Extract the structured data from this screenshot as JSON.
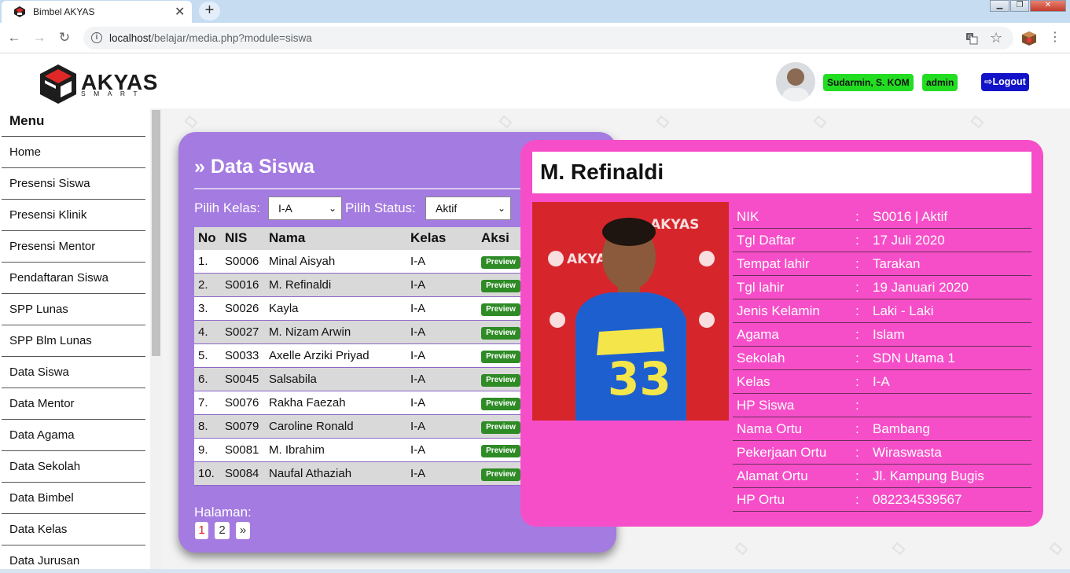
{
  "browser": {
    "tab_title": "Bimbel AKYAS",
    "new_tab": "+",
    "close_tab": "✕",
    "url_host": "localhost",
    "url_path": "/belajar/media.php?module=siswa"
  },
  "header": {
    "logo_text": "AKYAS",
    "logo_sub": "SMART",
    "user_name": "Sudarmin, S. KOM",
    "user_role": "admin",
    "logout_label": "Logout"
  },
  "sidebar": {
    "title": "Menu",
    "items": [
      {
        "label": "Home"
      },
      {
        "label": "Presensi Siswa"
      },
      {
        "label": "Presensi Klinik"
      },
      {
        "label": "Presensi Mentor"
      },
      {
        "label": "Pendaftaran Siswa"
      },
      {
        "label": "SPP Lunas"
      },
      {
        "label": "SPP Blm Lunas"
      },
      {
        "label": "Data Siswa"
      },
      {
        "label": "Data Mentor"
      },
      {
        "label": "Data Agama"
      },
      {
        "label": "Data Sekolah"
      },
      {
        "label": "Data Bimbel"
      },
      {
        "label": "Data Kelas"
      },
      {
        "label": "Data Jurusan"
      }
    ]
  },
  "panel": {
    "title": "Data Siswa",
    "kelas_label": "Pilih Kelas:",
    "kelas_value": "I-A",
    "status_label": "Pilih Status:",
    "status_value": "Aktif",
    "columns": [
      "No",
      "NIS",
      "Nama",
      "Kelas",
      "Aksi"
    ],
    "rows": [
      {
        "no": "1.",
        "nis": "S0006",
        "nama": "Minal Aisyah",
        "kelas": "I-A"
      },
      {
        "no": "2.",
        "nis": "S0016",
        "nama": "M. Refinaldi",
        "kelas": "I-A"
      },
      {
        "no": "3.",
        "nis": "S0026",
        "nama": "Kayla",
        "kelas": "I-A"
      },
      {
        "no": "4.",
        "nis": "S0027",
        "nama": "M. Nizam Arwin",
        "kelas": "I-A"
      },
      {
        "no": "5.",
        "nis": "S0033",
        "nama": "Axelle Arziki Priyad",
        "kelas": "I-A"
      },
      {
        "no": "6.",
        "nis": "S0045",
        "nama": "Salsabila",
        "kelas": "I-A"
      },
      {
        "no": "7.",
        "nis": "S0076",
        "nama": "Rakha Faezah",
        "kelas": "I-A"
      },
      {
        "no": "8.",
        "nis": "S0079",
        "nama": "Caroline Ronald",
        "kelas": "I-A"
      },
      {
        "no": "9.",
        "nis": "S0081",
        "nama": "M. Ibrahim",
        "kelas": "I-A"
      },
      {
        "no": "10.",
        "nis": "S0084",
        "nama": "Naufal Athaziah",
        "kelas": "I-A"
      }
    ],
    "preview_label": "Preview",
    "halaman_label": "Halaman:",
    "pages": [
      "1",
      "2",
      "»"
    ]
  },
  "detail": {
    "name": "M. Refinaldi",
    "photo_text": "AKYAS",
    "fields": [
      {
        "key": "NIK",
        "value": "S0016 | Aktif"
      },
      {
        "key": "Tgl Daftar",
        "value": "17 Juli 2020"
      },
      {
        "key": "Tempat lahir",
        "value": "Tarakan"
      },
      {
        "key": "Tgl lahir",
        "value": "19 Januari 2020"
      },
      {
        "key": "Jenis Kelamin",
        "value": "Laki - Laki"
      },
      {
        "key": "Agama",
        "value": "Islam"
      },
      {
        "key": "Sekolah",
        "value": "SDN Utama 1"
      },
      {
        "key": "Kelas",
        "value": "I-A"
      },
      {
        "key": "HP Siswa",
        "value": ""
      },
      {
        "key": "Nama Ortu",
        "value": "Bambang"
      },
      {
        "key": "Pekerjaan Ortu",
        "value": "Wiraswasta"
      },
      {
        "key": "Alamat Ortu",
        "value": "Jl. Kampung Bugis"
      },
      {
        "key": "HP Ortu",
        "value": "082234539567"
      }
    ]
  },
  "colors": {
    "panel_purple": "#a47be0",
    "modal_pink": "#f64ec8",
    "badge_green": "#22dd22",
    "logout_blue": "#1212c8",
    "preview_green": "#2e8b25"
  }
}
